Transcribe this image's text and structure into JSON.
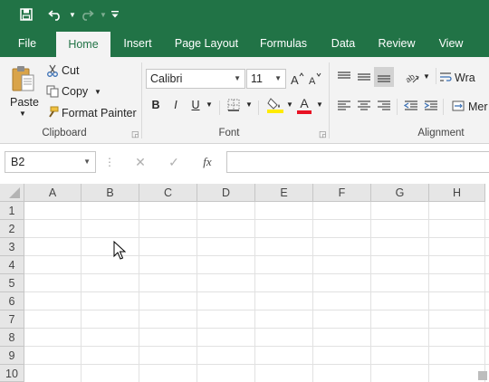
{
  "quick_access": {
    "save": "save-icon",
    "undo": "undo-icon",
    "redo": "redo-icon",
    "customize": "customize-icon"
  },
  "tabs": [
    {
      "label": "File"
    },
    {
      "label": "Home"
    },
    {
      "label": "Insert"
    },
    {
      "label": "Page Layout"
    },
    {
      "label": "Formulas"
    },
    {
      "label": "Data"
    },
    {
      "label": "Review"
    },
    {
      "label": "View"
    }
  ],
  "active_tab": "Home",
  "clipboard": {
    "paste": "Paste",
    "cut": "Cut",
    "copy": "Copy",
    "format_painter": "Format Painter",
    "group_label": "Clipboard"
  },
  "font": {
    "name": "Calibri",
    "size": "11",
    "bold": "B",
    "italic": "I",
    "underline": "U",
    "font_color_letter": "A",
    "font_color": "#e81123",
    "fill_color": "#ffeb00",
    "group_label": "Font"
  },
  "alignment": {
    "wrap": "Wra",
    "merge": "Mer",
    "group_label": "Alignment"
  },
  "formula_bar": {
    "name_box": "B2",
    "fx": "fx",
    "value": ""
  },
  "grid": {
    "columns": [
      "A",
      "B",
      "C",
      "D",
      "E",
      "F",
      "G",
      "H"
    ],
    "rows": [
      "1",
      "2",
      "3",
      "4",
      "5",
      "6",
      "7",
      "8",
      "9",
      "10"
    ]
  },
  "colors": {
    "accent": "#217346",
    "ribbon_bg": "#f3f3f3",
    "header_bg": "#e6e6e6"
  }
}
